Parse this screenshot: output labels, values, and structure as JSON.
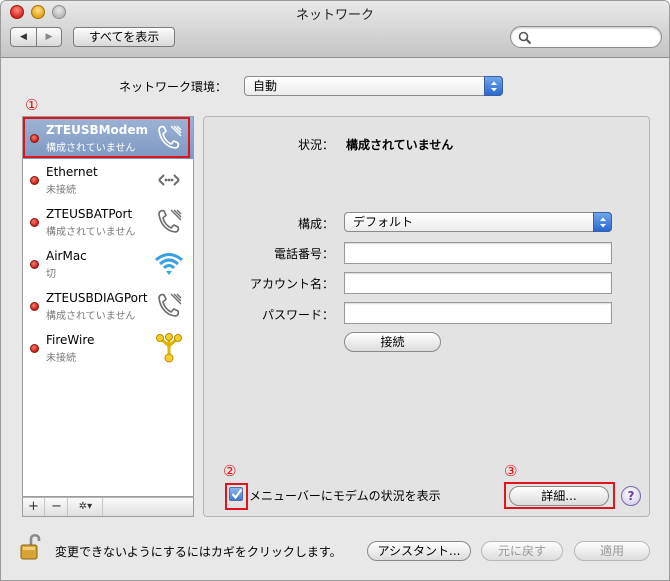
{
  "window": {
    "title": "ネットワーク"
  },
  "toolbar": {
    "show_all": "すべてを表示",
    "search_placeholder": ""
  },
  "location": {
    "label": "ネットワーク環境：",
    "value": "自動"
  },
  "services": [
    {
      "name": "ZTEUSBModem",
      "status": "構成されていません",
      "icon": "phone-modem-icon",
      "selected": true
    },
    {
      "name": "Ethernet",
      "status": "未接続",
      "icon": "ethernet-icon",
      "selected": false
    },
    {
      "name": "ZTEUSBATPort",
      "status": "構成されていません",
      "icon": "phone-modem-icon",
      "selected": false
    },
    {
      "name": "AirMac",
      "status": "切",
      "icon": "wifi-icon",
      "selected": false
    },
    {
      "name": "ZTEUSBDIAGPort",
      "status": "構成されていません",
      "icon": "phone-modem-icon",
      "selected": false
    },
    {
      "name": "FireWire",
      "status": "未接続",
      "icon": "firewire-icon",
      "selected": false
    }
  ],
  "sidebar_buttons": {
    "add": "+",
    "remove": "−",
    "action": "✲▾"
  },
  "detail": {
    "status_label": "状況：",
    "status_value": "構成されていません",
    "config_label": "構成：",
    "config_value": "デフォルト",
    "phone_label": "電話番号：",
    "account_label": "アカウント名：",
    "password_label": "パスワード：",
    "phone_value": "",
    "account_value": "",
    "password_value": "",
    "connect_button": "接続",
    "show_in_menubar": "メニューバーにモデムの状況を表示",
    "advanced_button": "詳細...",
    "help_button": "?"
  },
  "footer": {
    "lock_text": "変更できないようにするにはカギをクリックします。",
    "assistant_button": "アシスタント...",
    "revert_button": "元に戻す",
    "apply_button": "適用"
  },
  "annotations": {
    "c1": "①",
    "c2": "②",
    "c3": "③"
  },
  "colors": {
    "selection": "#8aa3cb",
    "highlight_box": "#e0141c",
    "status_dot": "#d0221a"
  }
}
